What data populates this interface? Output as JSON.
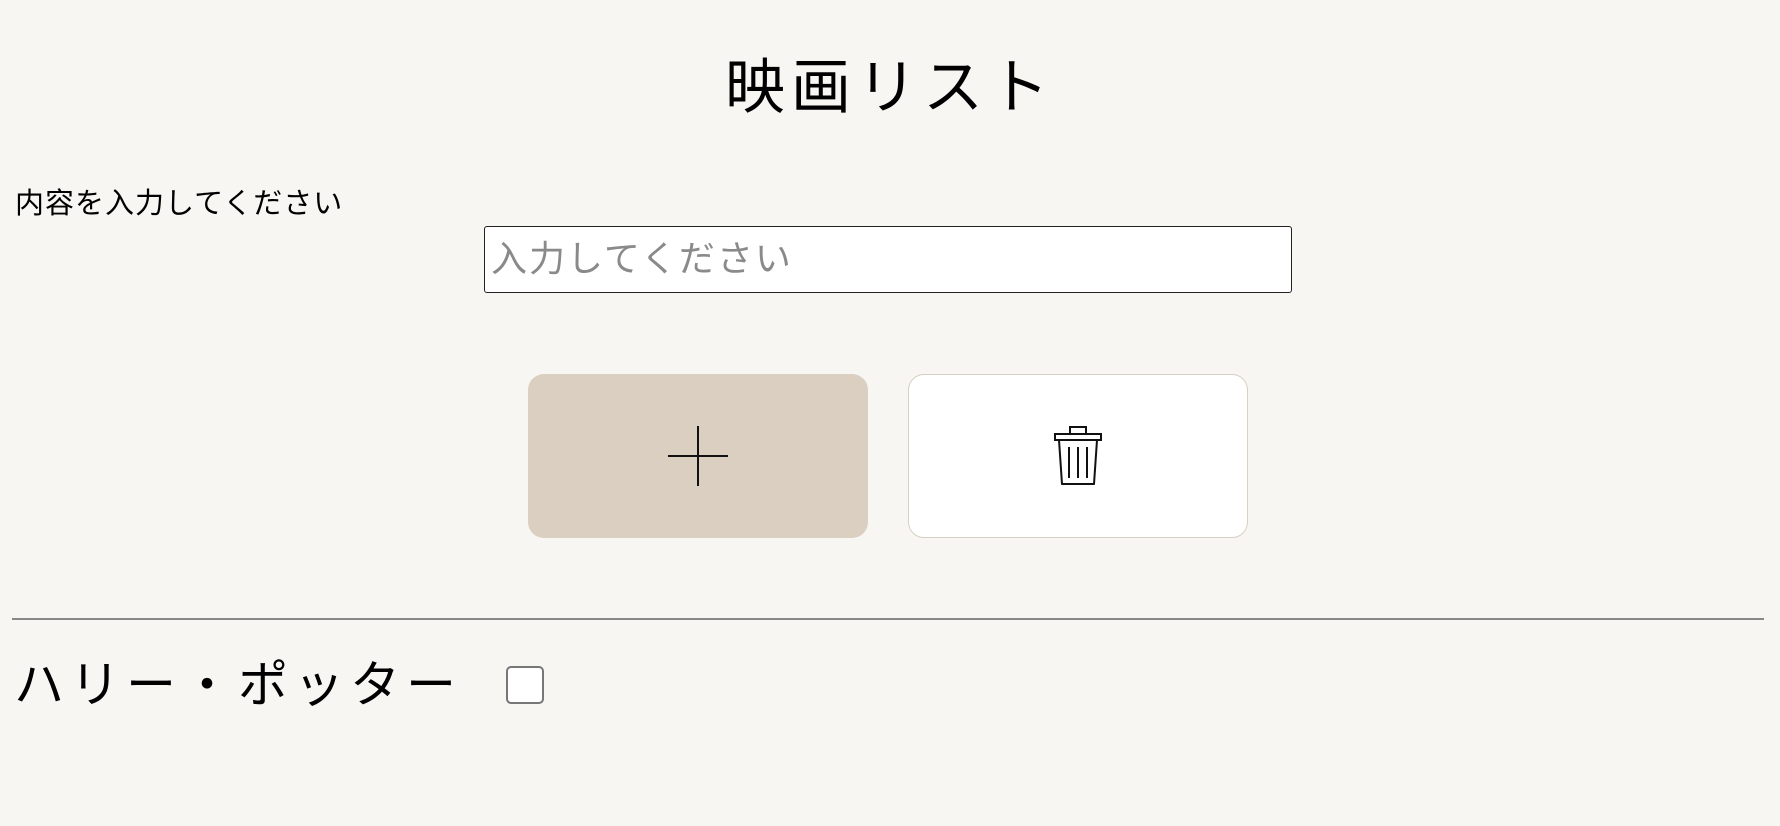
{
  "header": {
    "title": "映画リスト"
  },
  "form": {
    "label": "内容を入力してください",
    "input_value": "",
    "input_placeholder": "入力してください"
  },
  "buttons": {
    "add_icon": "plus-icon",
    "delete_icon": "trash-icon",
    "add_color": "#dacfc0",
    "delete_color": "#ffffff"
  },
  "list": {
    "items": [
      {
        "label": "ハリー・ポッター",
        "checked": false
      }
    ]
  }
}
